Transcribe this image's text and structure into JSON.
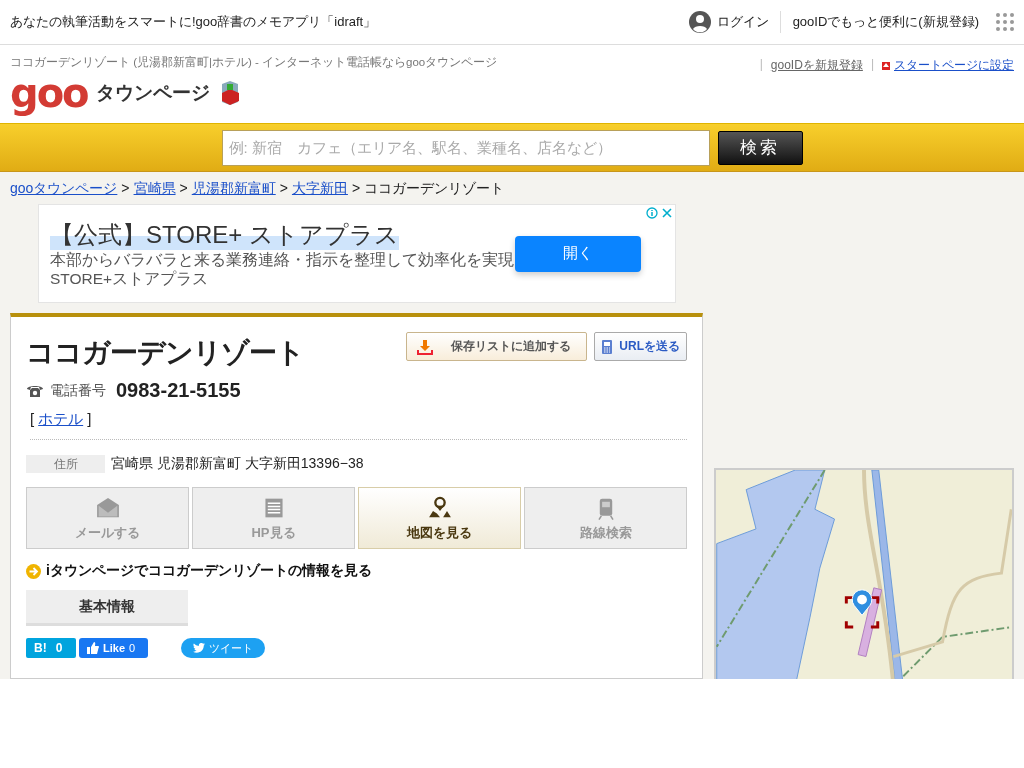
{
  "top_bar": {
    "promo": "あなたの執筆活動をスマートに!goo辞書のメモアプリ「idraft」",
    "login": "ログイン",
    "register": "gooIDでもっと便利に(新規登録)"
  },
  "header": {
    "page_title": "ココガーデンリゾート (児湯郡新富町|ホテル) - インターネット電話帳ならgooタウンページ",
    "logo": "goo",
    "logo_sub": "タウンページ",
    "links": [
      {
        "text": "|",
        "kind": "divider"
      },
      {
        "text": "gooIDを新規登録",
        "kind": "plain"
      },
      {
        "text": "|",
        "kind": "divider"
      },
      {
        "text": "スタートページに設定",
        "kind": "start"
      }
    ]
  },
  "search": {
    "placeholder": "例: 新宿　カフェ（エリア名、駅名、業種名、店名など）",
    "button": "検索"
  },
  "breadcrumb": [
    {
      "text": "gooタウンページ",
      "kind": "link"
    },
    {
      "text": ">",
      "kind": "separator"
    },
    {
      "text": "宮崎県",
      "kind": "link"
    },
    {
      "text": ">",
      "kind": "separator"
    },
    {
      "text": "児湯郡新富町",
      "kind": "link"
    },
    {
      "text": ">",
      "kind": "separator"
    },
    {
      "text": "大字新田",
      "kind": "link"
    },
    {
      "text": ">",
      "kind": "separator"
    },
    {
      "text": "ココガーデンリゾート",
      "kind": "current"
    }
  ],
  "ad": {
    "title": "【公式】STORE+ ストアプラス",
    "lines": [
      "本部からバラバラと来る業務連絡・指示を整理して効率化を実現",
      "STORE+ストアプラス"
    ],
    "button": "開く"
  },
  "listing": {
    "name": "ココガーデンリゾート",
    "save_button": "保存リストに追加する",
    "url_button": "URLを送る",
    "phone_label": "電話番号",
    "phone": "0983-21-5155",
    "category_open": "[",
    "category": "ホテル",
    "category_close": "]",
    "address_label": "住所",
    "address": "宮崎県 児湯郡新富町 大字新田13396−38",
    "actions": [
      {
        "label": "メールする",
        "kind": "mail",
        "disabled": true
      },
      {
        "label": "HP見る",
        "kind": "web",
        "disabled": true
      },
      {
        "label": "地図を見る",
        "kind": "map",
        "disabled": false
      },
      {
        "label": "路線検索",
        "kind": "train",
        "disabled": true
      }
    ],
    "itownpage_link": "iタウンページでココガーデンリゾートの情報を見る",
    "tabs": [
      {
        "label": "基本情報",
        "selected": true
      }
    ],
    "social": {
      "hatena": "B!",
      "hatena_count": "0",
      "like": "Like",
      "like_count": "0",
      "tweet": "ツイート"
    }
  }
}
